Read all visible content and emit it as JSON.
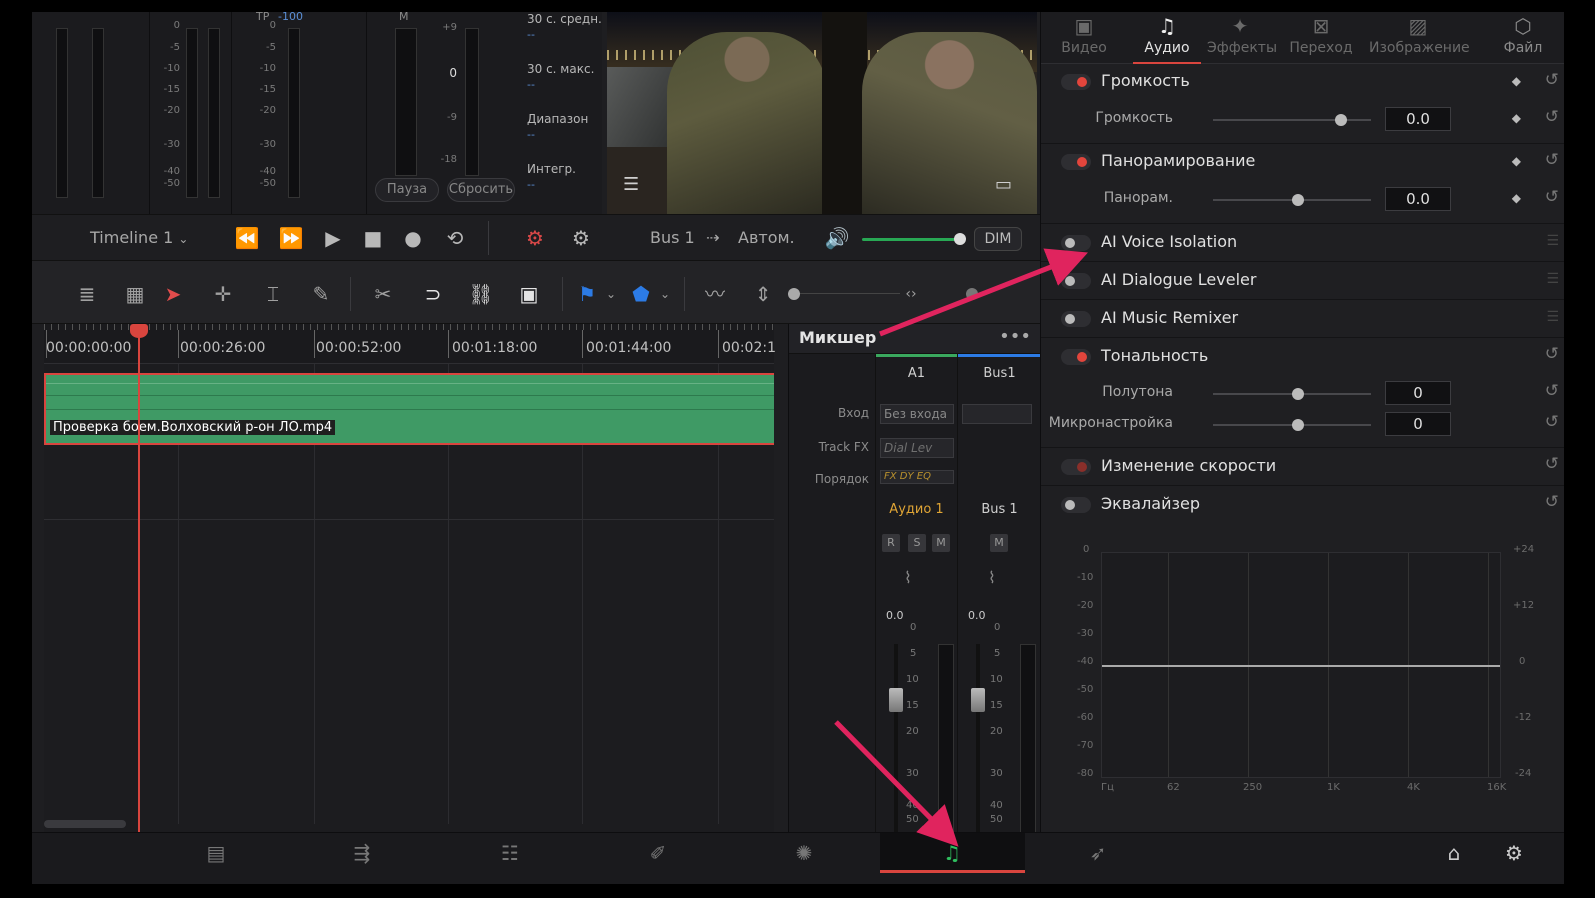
{
  "meters": {
    "block1_scale": [
      "0",
      "-5",
      "-10",
      "-15",
      "-20",
      "-30",
      "-40",
      "-50"
    ],
    "tp_label": "TP",
    "tp_value": "-100",
    "m_label": "M",
    "block3_scale": [
      "0",
      "-5",
      "-10",
      "-15",
      "-20",
      "-30",
      "-40",
      "-50"
    ],
    "block4_scale": [
      "+9",
      "0",
      "-9",
      "-18"
    ],
    "block4_zero": "0",
    "pause_button": "Пауза",
    "reset_button": "Сбросить",
    "loudness": [
      {
        "label": "30 с. средн.",
        "value": "--"
      },
      {
        "label": "30 с. макс.",
        "value": "--"
      },
      {
        "label": "Диапазон",
        "value": "--"
      },
      {
        "label": "Интегр.",
        "value": "--"
      }
    ]
  },
  "transport": {
    "timeline_name": "Timeline 1",
    "bus_label": "Bus 1",
    "arrow_label": "⇢",
    "mode_label": "Автом.",
    "dim_label": "DIM",
    "volume_level": 0.95
  },
  "timeline": {
    "timecodes": [
      "00:00:00:00",
      "00:00:26:00",
      "00:00:52:00",
      "00:01:18:00",
      "00:01:44:00",
      "00:02:1"
    ],
    "clip_name": "Проверка боем.Волховский р-он ЛО.mp4"
  },
  "mixer": {
    "title": "Микшер",
    "more_label": "•••",
    "row_labels": {
      "input": "Вход",
      "trackfx": "Track FX",
      "order": "Порядок"
    },
    "strips": [
      {
        "name": "A1",
        "input": "Без входа",
        "fx": "Dial Lev",
        "order": "FX DY EQ",
        "track": "Аудио 1",
        "buttons": [
          "R",
          "S",
          "M"
        ],
        "value": "0.0",
        "color": "#3aa85e"
      },
      {
        "name": "Bus1",
        "input": "",
        "fx": "",
        "order": "",
        "track": "Bus 1",
        "buttons": [
          "M"
        ],
        "value": "0.0",
        "color": "#2c7be5"
      }
    ],
    "fader_scale": [
      "0",
      "5",
      "10",
      "15",
      "20",
      "30",
      "40",
      "50"
    ]
  },
  "inspector": {
    "tabs": [
      {
        "label": "Видео",
        "icon": "video-icon"
      },
      {
        "label": "Аудио",
        "icon": "music-note-icon"
      },
      {
        "label": "Эффекты",
        "icon": "effects-icon"
      },
      {
        "label": "Переход",
        "icon": "transition-icon"
      },
      {
        "label": "Изображение",
        "icon": "image-icon"
      },
      {
        "label": "Файл",
        "icon": "file-icon"
      }
    ],
    "volume": {
      "title": "Громкость",
      "param": "Громкость",
      "value": "0.0"
    },
    "pan": {
      "title": "Панорамирование",
      "param": "Панорам.",
      "value": "0.0"
    },
    "voice_isolation": {
      "title": "AI Voice Isolation"
    },
    "dialogue_leveler": {
      "title": "AI Dialogue Leveler"
    },
    "music_remixer": {
      "title": "AI Music Remixer"
    },
    "pitch": {
      "title": "Тональность",
      "semitones_label": "Полутона",
      "semitones_value": "0",
      "cents_label": "Микронастройка",
      "cents_value": "0"
    },
    "speed": {
      "title": "Изменение скорости"
    },
    "eq": {
      "title": "Эквалайзер",
      "left_scale": [
        "0",
        "-10",
        "-20",
        "-30",
        "-40",
        "-50",
        "-60",
        "-70",
        "-80"
      ],
      "right_scale": [
        "+24",
        "+12",
        "0",
        "-12",
        "-24"
      ],
      "freq_labels": [
        "Гц",
        "62",
        "250",
        "1K",
        "4K",
        "16K"
      ]
    }
  },
  "colors": {
    "accent_red": "#d9453e",
    "track_green": "#3f9a65",
    "active_page": "#2fbf5f"
  }
}
